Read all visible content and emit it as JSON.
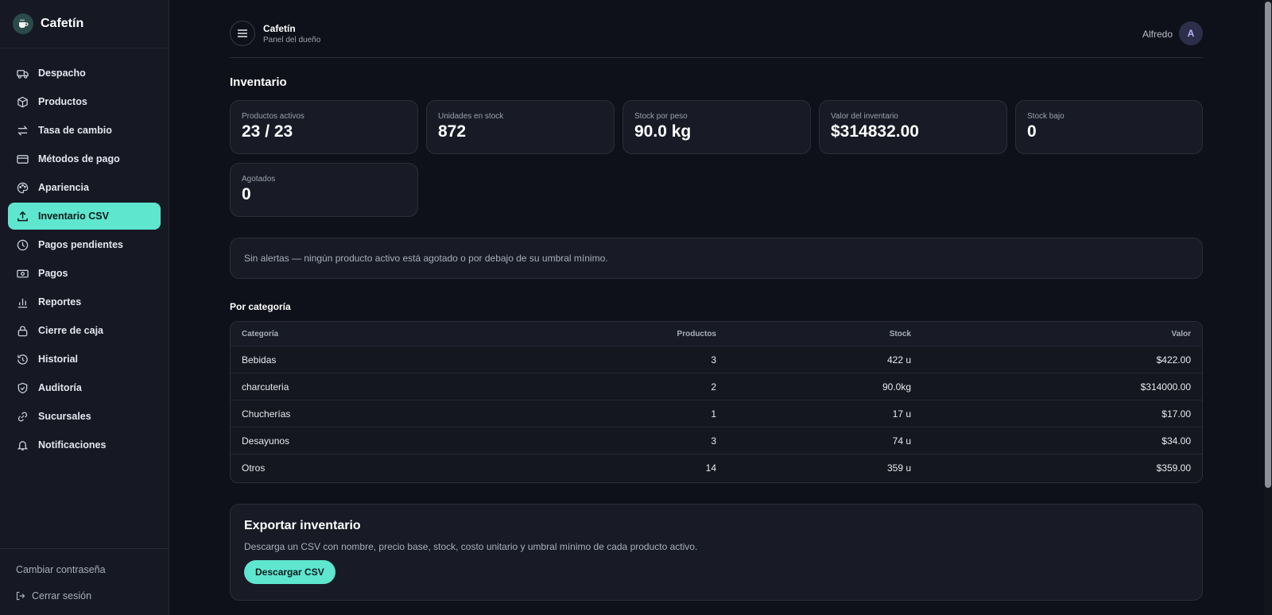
{
  "brand": {
    "name": "Cafetín"
  },
  "sidebar": {
    "items": [
      {
        "label": "Despacho",
        "icon": "truck-icon"
      },
      {
        "label": "Productos",
        "icon": "box-icon"
      },
      {
        "label": "Tasa de cambio",
        "icon": "swap-icon"
      },
      {
        "label": "Métodos de pago",
        "icon": "credit-card-icon"
      },
      {
        "label": "Apariencia",
        "icon": "palette-icon"
      },
      {
        "label": "Inventario CSV",
        "icon": "upload-icon",
        "active": true
      },
      {
        "label": "Pagos pendientes",
        "icon": "clock-icon"
      },
      {
        "label": "Pagos",
        "icon": "banknote-icon"
      },
      {
        "label": "Reportes",
        "icon": "bar-chart-icon"
      },
      {
        "label": "Cierre de caja",
        "icon": "lock-icon"
      },
      {
        "label": "Historial",
        "icon": "history-icon"
      },
      {
        "label": "Auditoría",
        "icon": "shield-icon"
      },
      {
        "label": "Sucursales",
        "icon": "link-icon"
      },
      {
        "label": "Notificaciones",
        "icon": "bell-icon"
      }
    ],
    "change_password": "Cambiar contraseña",
    "logout": "Cerrar sesión"
  },
  "header": {
    "title": "Cafetín",
    "subtitle": "Panel del dueño",
    "user_name": "Alfredo",
    "avatar_initial": "A"
  },
  "page": {
    "title": "Inventario"
  },
  "stats": [
    {
      "label": "Productos activos",
      "value": "23 / 23"
    },
    {
      "label": "Unidades en stock",
      "value": "872"
    },
    {
      "label": "Stock por peso",
      "value": "90.0 kg"
    },
    {
      "label": "Valor del inventario",
      "value": "$314832.00"
    },
    {
      "label": "Stock bajo",
      "value": "0"
    },
    {
      "label": "Agotados",
      "value": "0"
    }
  ],
  "alert": {
    "text": "Sin alertas — ningún producto activo está agotado o por debajo de su umbral mínimo."
  },
  "category_section": {
    "title": "Por categoría",
    "columns": [
      "Categoría",
      "Productos",
      "Stock",
      "Valor"
    ],
    "rows": [
      [
        "Bebidas",
        "3",
        "422 u",
        "$422.00"
      ],
      [
        "charcuteria",
        "2",
        "90.0kg",
        "$314000.00"
      ],
      [
        "Chucherías",
        "1",
        "17 u",
        "$17.00"
      ],
      [
        "Desayunos",
        "3",
        "74 u",
        "$34.00"
      ],
      [
        "Otros",
        "14",
        "359 u",
        "$359.00"
      ]
    ]
  },
  "export": {
    "title": "Exportar inventario",
    "description": "Descarga un CSV con nombre, precio base, stock, costo unitario y umbral mínimo de cada producto activo.",
    "button_label": "Descargar CSV"
  },
  "colors": {
    "accent": "#5ee6cf",
    "background": "#0f111a",
    "surface": "#181b26"
  }
}
